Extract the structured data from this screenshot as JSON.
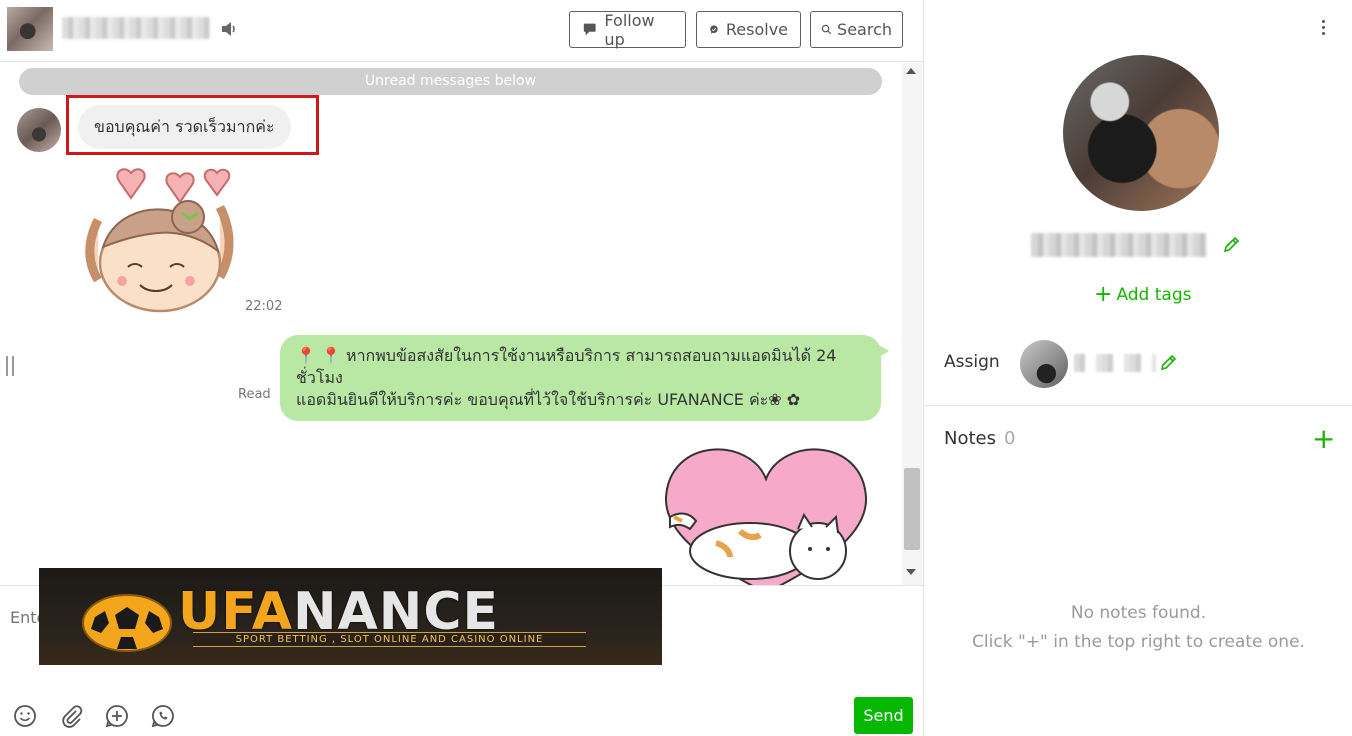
{
  "header": {
    "buttons": {
      "follow_up": "Follow up",
      "resolve": "Resolve",
      "search": "Search"
    }
  },
  "messages": {
    "unread_divider": "Unread messages below",
    "incoming": {
      "text": "ขอบคุณค่า รวดเร็วมากค่ะ",
      "time": "22:02"
    },
    "outgoing": {
      "status": "Read",
      "lines": [
        "📍 📍 หากพบข้อสงสัยในการใช้งานหรือบริการ สามารถสอบถามแอดมินได้ 24",
        "ชั่วโมง",
        "แอดมินยินดีให้บริการค่ะ ขอบคุณที่ไว้ใจใช้บริการค่ะ UFANANCE ค่ะ❀ ✿"
      ]
    }
  },
  "composer": {
    "placeholder": "Enter",
    "send_label": "Send",
    "tools": [
      "emoji-icon",
      "attachment-icon",
      "add-icon",
      "voice-icon"
    ]
  },
  "banner": {
    "title_gold": "UFA",
    "title_white": "NANCE",
    "subtitle": "SPORT BETTING , SLOT ONLINE AND CASINO ONLINE"
  },
  "profile": {
    "add_tags": "Add tags",
    "assign_label": "Assign"
  },
  "notes": {
    "title": "Notes",
    "count": "0",
    "empty_line_1": "No notes found.",
    "empty_line_2": "Click \"+\" in the top right to create one."
  },
  "colors": {
    "accent_green": "#06b900",
    "bubble_out": "#b9e8a4",
    "highlight_red": "#d0181b"
  }
}
